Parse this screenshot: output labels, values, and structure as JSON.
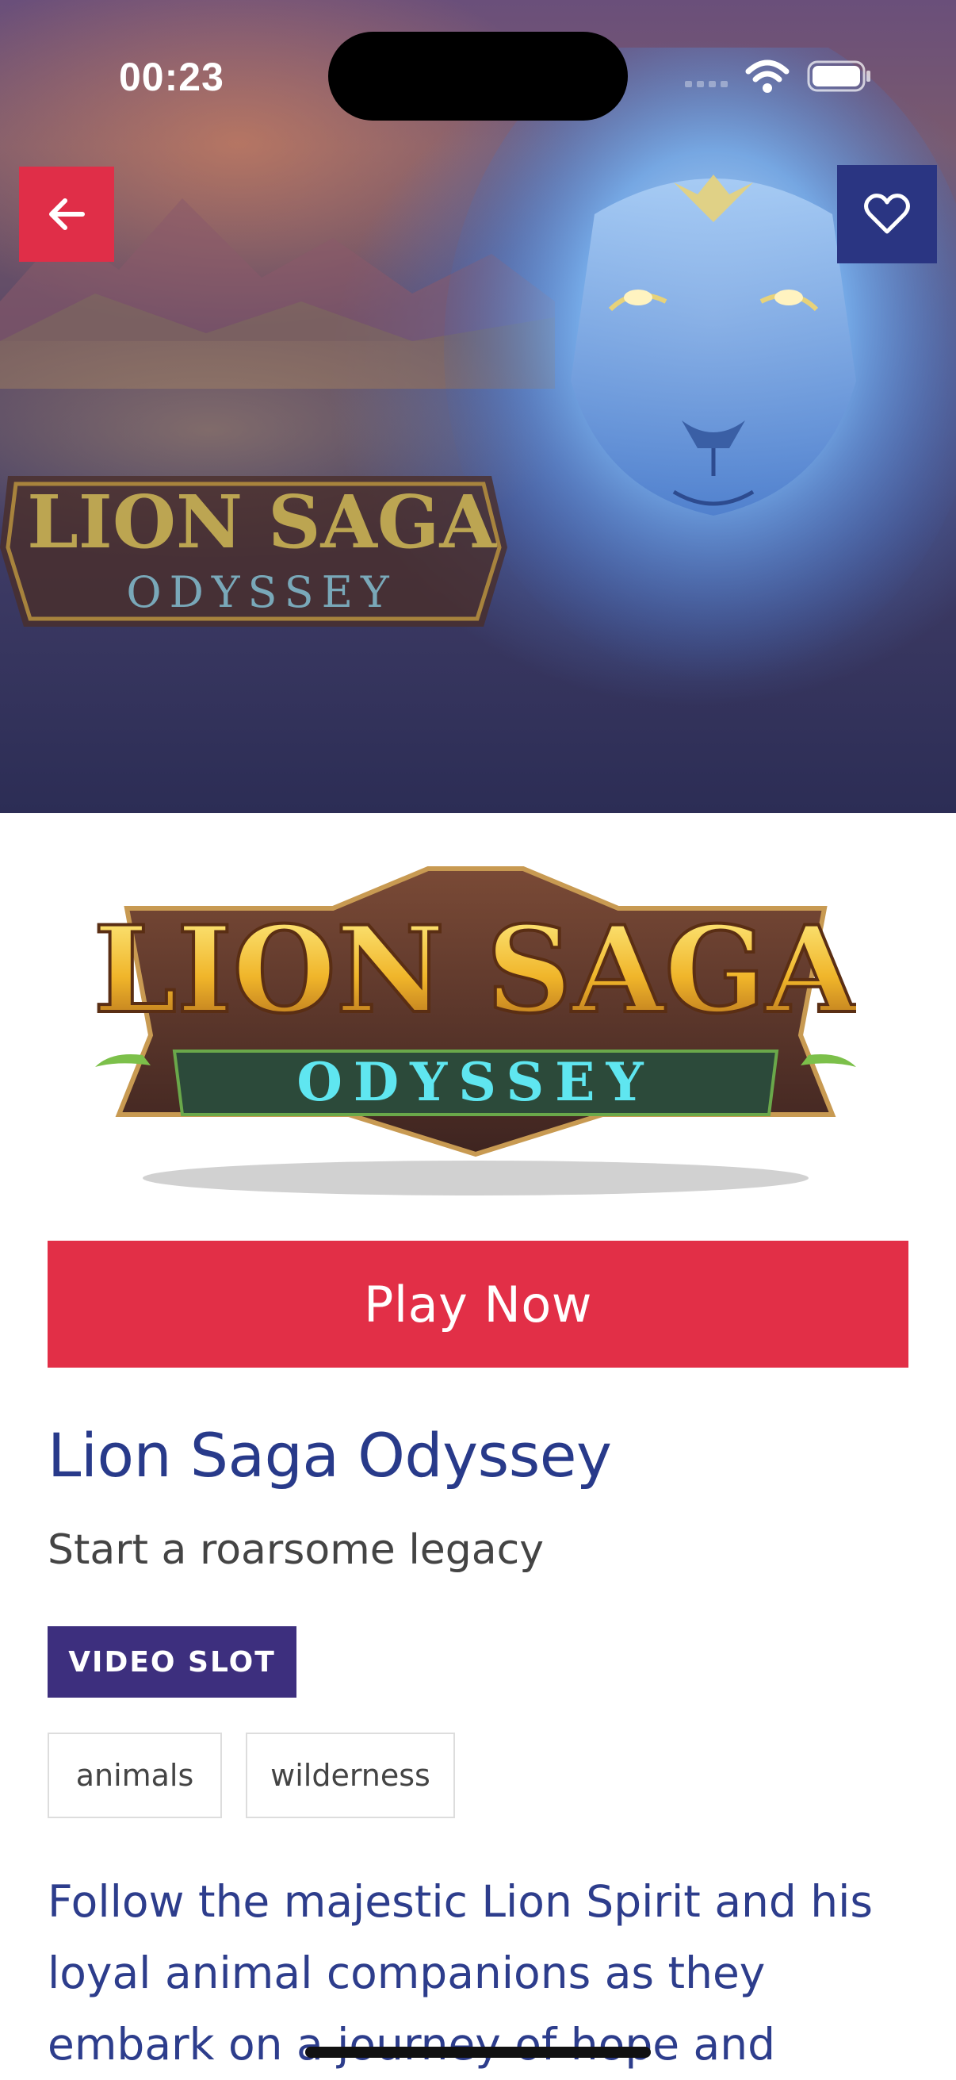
{
  "status_bar": {
    "time": "00:23"
  },
  "hero": {
    "logo_line1": "LION SAGA",
    "logo_line2": "ODYSSEY"
  },
  "logo": {
    "line1": "LION SAGA",
    "line2": "ODYSSEY"
  },
  "actions": {
    "play_label": "Play Now"
  },
  "game": {
    "title": "Lion Saga Odyssey",
    "tagline": "Start a roarsome legacy",
    "category": "VIDEO SLOT",
    "tags": [
      "animals",
      "wilderness"
    ],
    "description": "Follow the majestic Lion Spirit and his loyal animal companions as they embark on a journey of hope and"
  },
  "colors": {
    "accent_red": "#e22f47",
    "navy": "#2a3582",
    "title_blue": "#283a8a",
    "badge_purple": "#3d2f7e"
  }
}
